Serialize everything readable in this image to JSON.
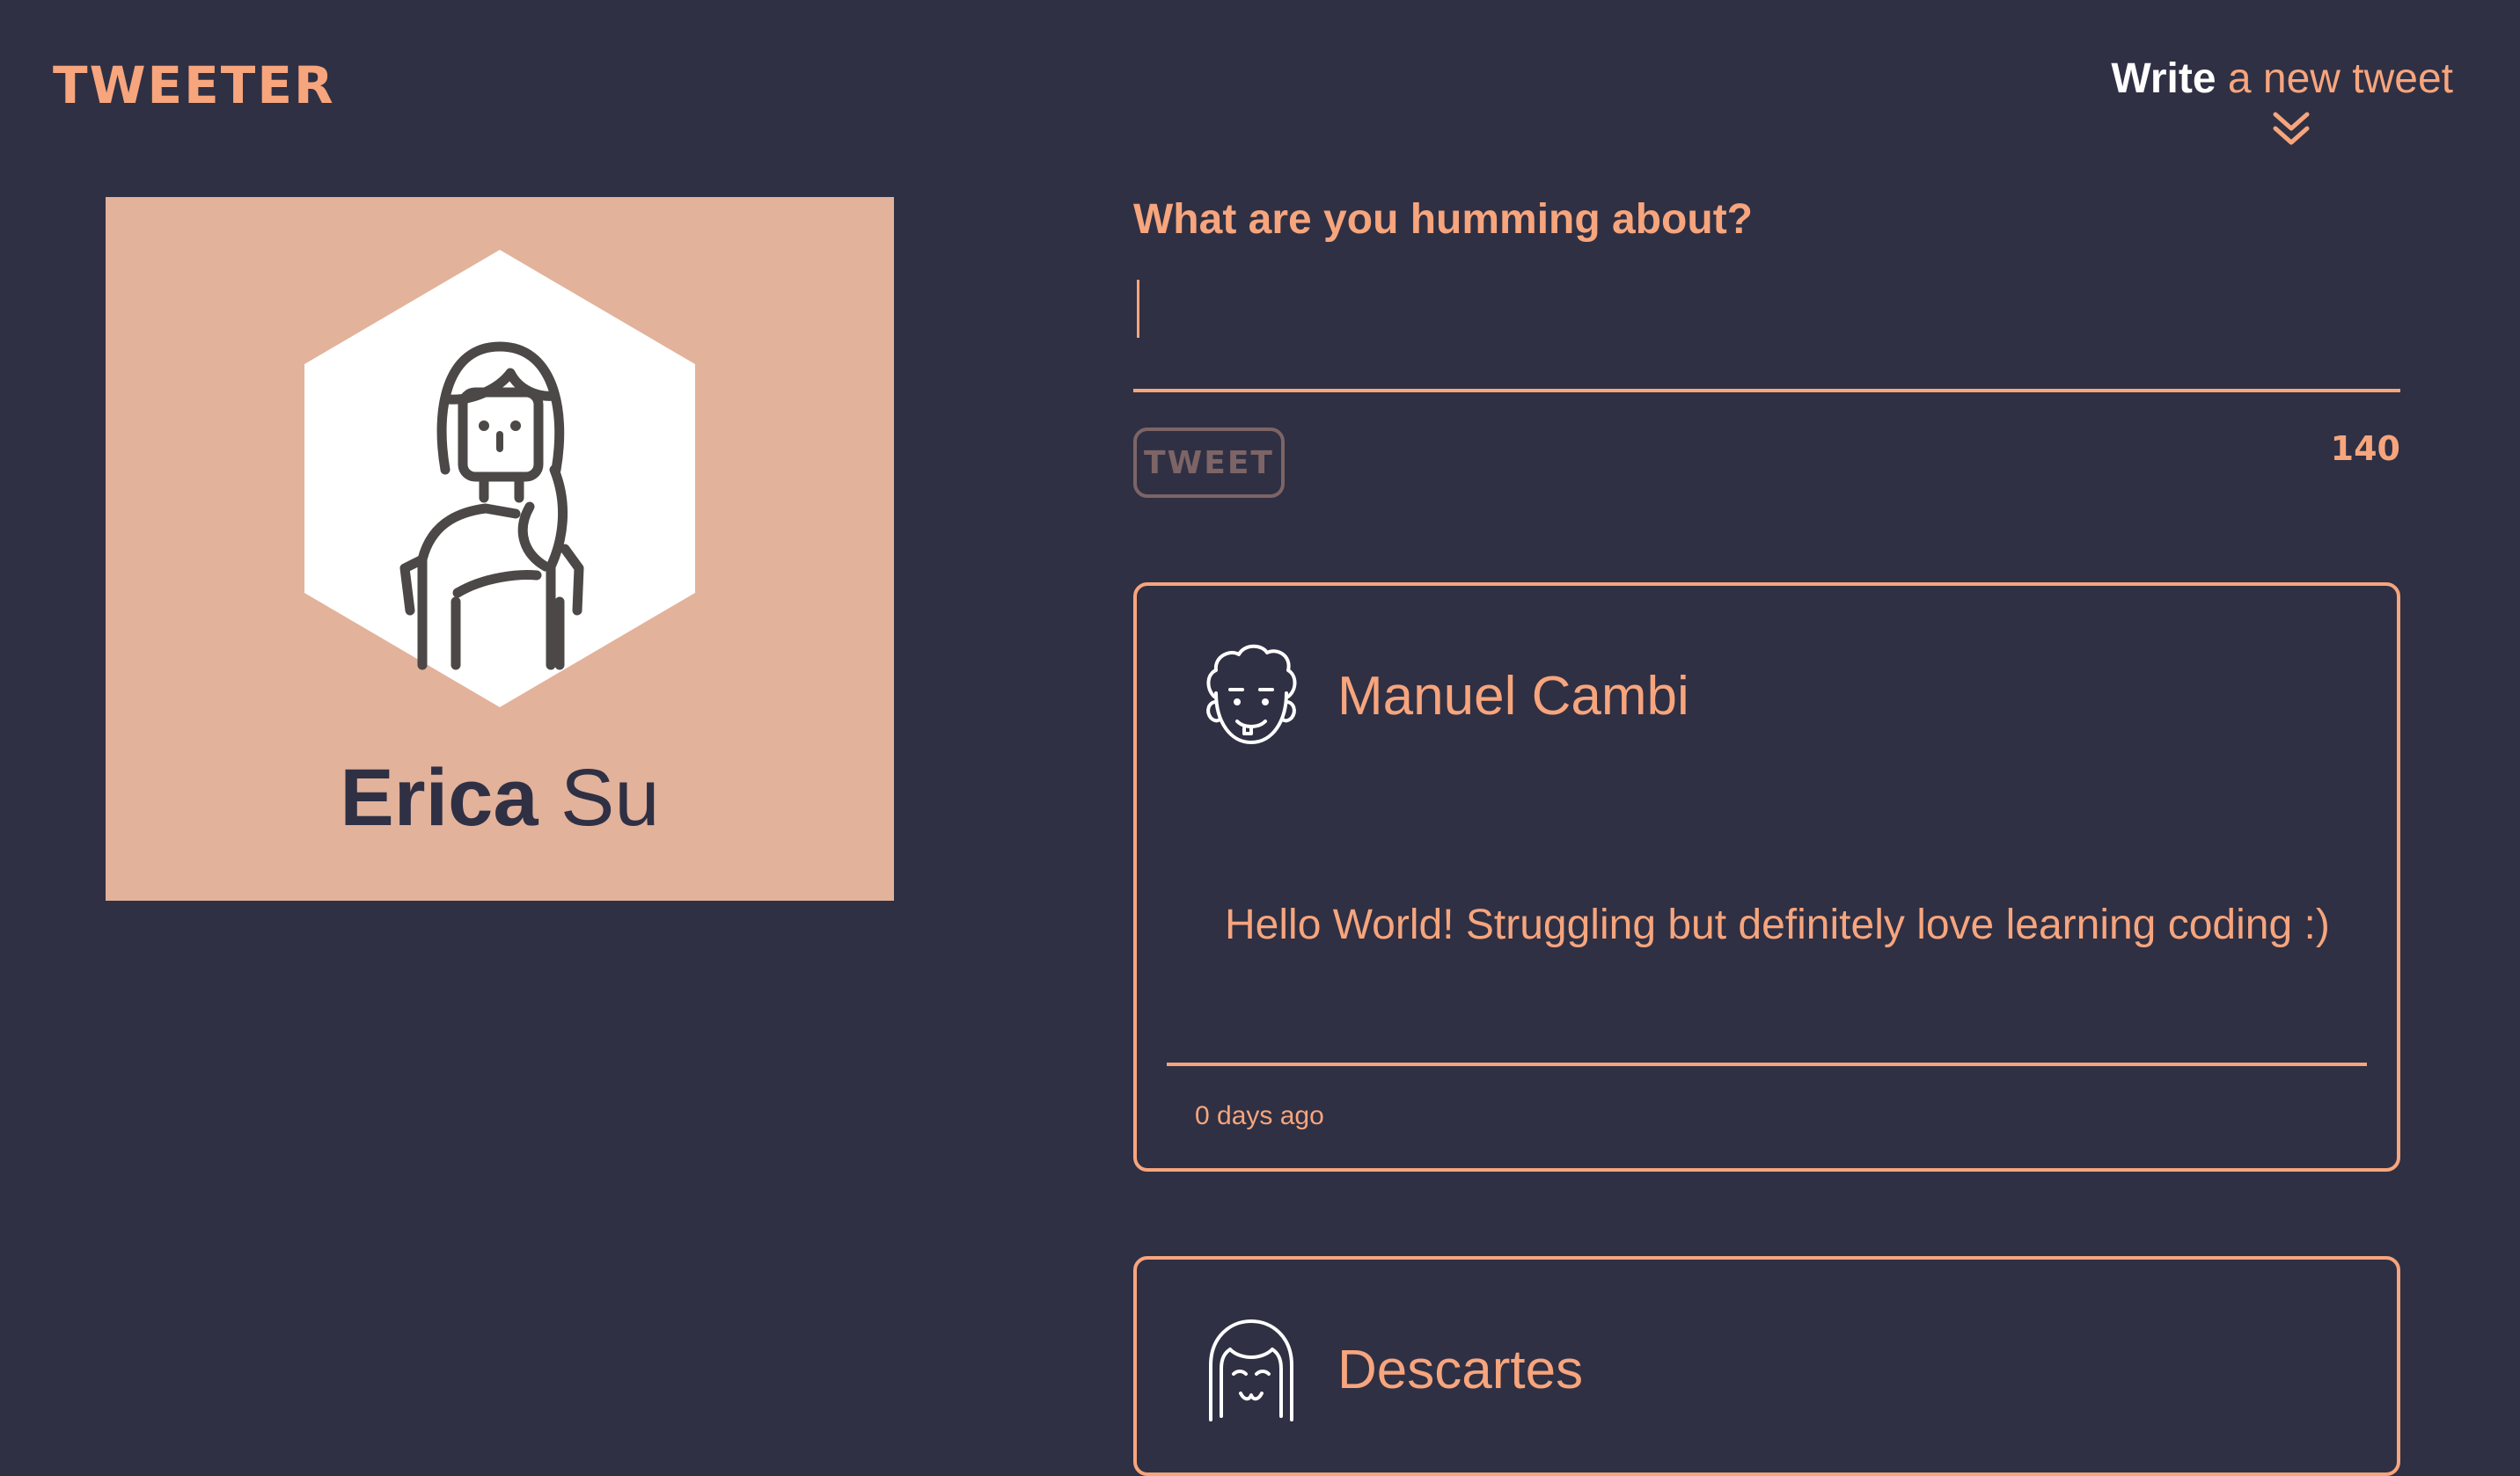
{
  "header": {
    "logo": "TWEETER",
    "write_strong": "Write",
    "write_rest": " a new tweet",
    "chevron_icon": "double-chevron-down-icon"
  },
  "profile": {
    "first_name": "Erica",
    "last_name": " Su",
    "avatar_icon": "woman-avatar-icon",
    "card_color": "#e2b29b"
  },
  "compose": {
    "label": "What are you humming about?",
    "value": "",
    "tweet_button": "TWEET",
    "char_count": "140"
  },
  "tweets": [
    {
      "author": "Manuel Cambi",
      "avatar_icon": "curly-hair-man-avatar-icon",
      "text": "Hello World! Struggling but definitely love learning coding :)",
      "time": "0 days ago"
    },
    {
      "author": "Descartes",
      "avatar_icon": "bob-hair-avatar-icon"
    }
  ],
  "colors": {
    "background": "#2f3044",
    "accent": "#f7a57d",
    "button_muted": "#7d6466"
  }
}
